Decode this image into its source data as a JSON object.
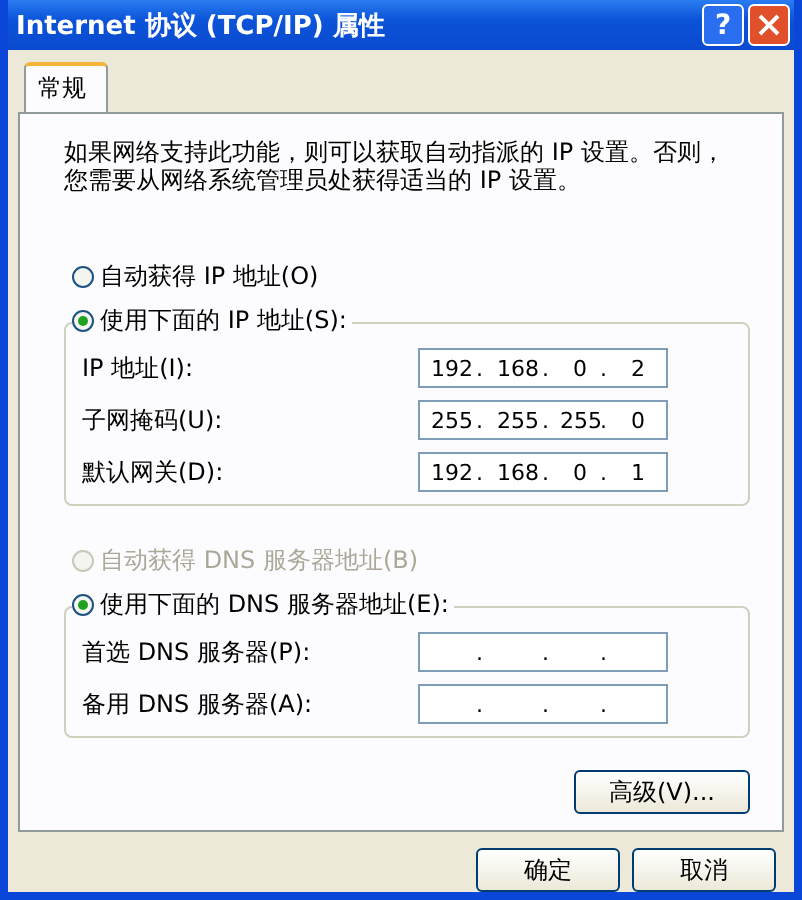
{
  "window": {
    "title": "Internet 协议 (TCP/IP) 属性",
    "help": "?"
  },
  "tabs": [
    {
      "label": "常规",
      "selected": true
    }
  ],
  "description": [
    "如果网络支持此功能，则可以获取自动指派的 IP 设置。否则，",
    "您需要从网络系统管理员处获得适当的 IP 设置。"
  ],
  "ip_section": {
    "auto_option": {
      "label": "自动获得 IP 地址(O)",
      "selected": false,
      "disabled": false
    },
    "manual_option": {
      "label": "使用下面的 IP 地址(S):",
      "selected": true,
      "disabled": false
    },
    "fields": [
      {
        "label": "IP 地址(I):",
        "octets": [
          "192",
          "168",
          "0",
          "2"
        ],
        "dots": [
          ".",
          ".",
          "."
        ]
      },
      {
        "label": "子网掩码(U):",
        "octets": [
          "255",
          "255",
          "255",
          "0"
        ],
        "dots": [
          ".",
          ".",
          "."
        ]
      },
      {
        "label": "默认网关(D):",
        "octets": [
          "192",
          "168",
          "0",
          "1"
        ],
        "dots": [
          ".",
          ".",
          "."
        ]
      }
    ]
  },
  "dns_section": {
    "auto_option": {
      "label": "自动获得 DNS 服务器地址(B)",
      "selected": false,
      "disabled": true
    },
    "manual_option": {
      "label": "使用下面的 DNS 服务器地址(E):",
      "selected": true,
      "disabled": false
    },
    "fields": [
      {
        "label": "首选 DNS 服务器(P):",
        "dots": [
          ".",
          ".",
          "."
        ]
      },
      {
        "label": "备用 DNS 服务器(A):",
        "dots": [
          ".",
          ".",
          "."
        ]
      }
    ]
  },
  "advanced_button": "高级(V)...",
  "buttons": [
    "确定",
    "取消"
  ]
}
